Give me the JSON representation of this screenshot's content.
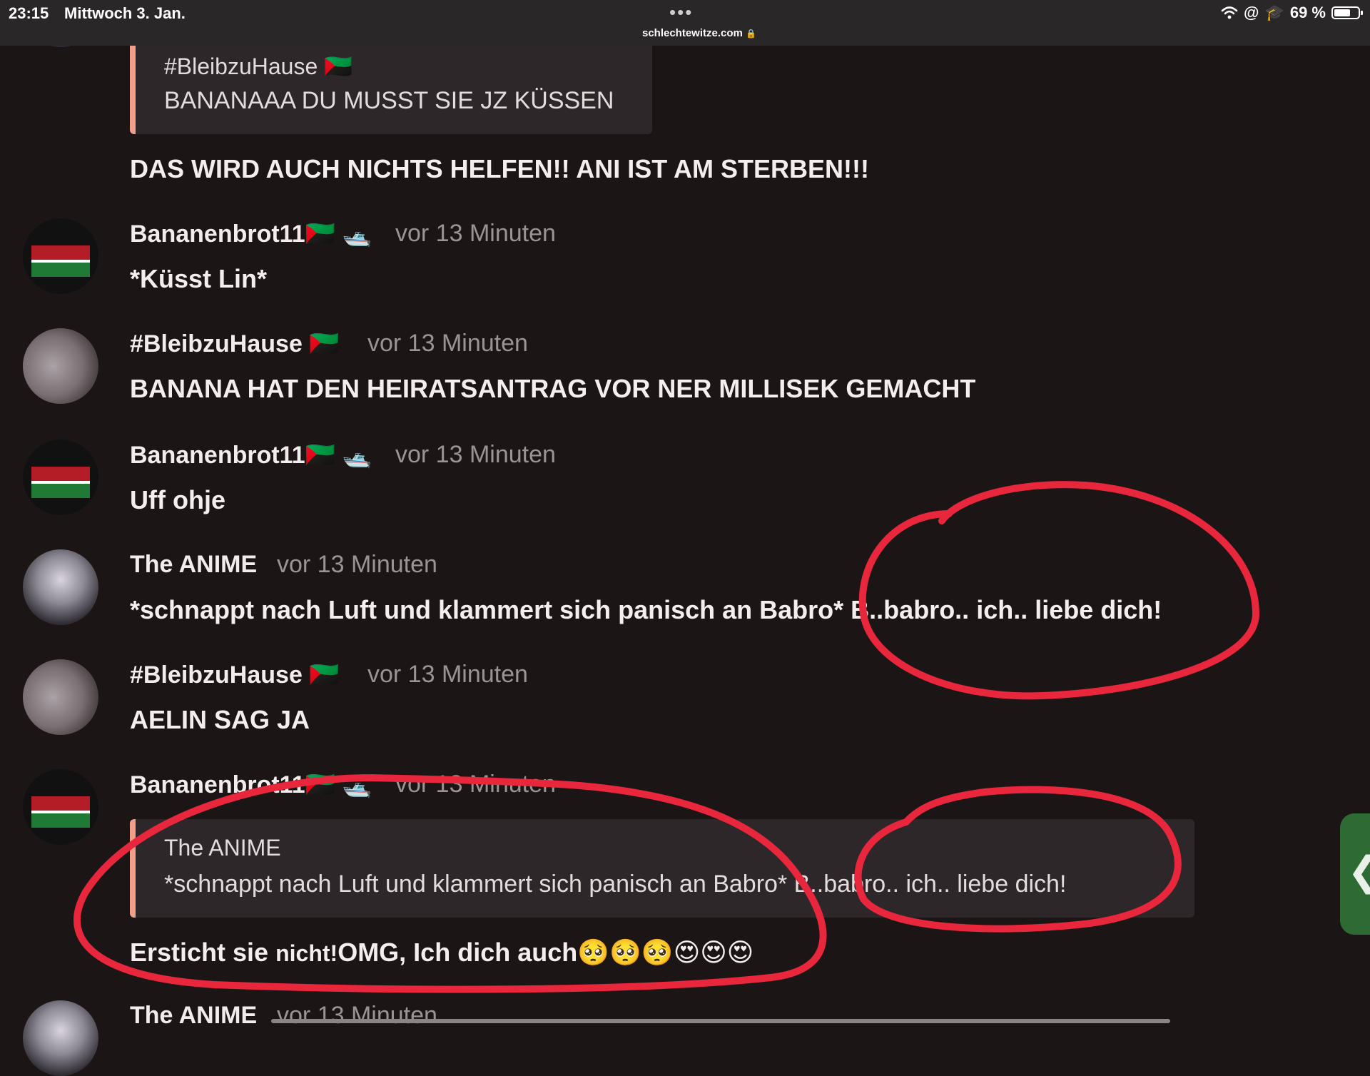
{
  "status_bar": {
    "time": "23:15",
    "date": "Mittwoch 3. Jan.",
    "url": "schlechtewitze.com",
    "battery_text": "69 %",
    "battery_level": 0.69,
    "icons": [
      "wifi-icon",
      "at-icon",
      "graduation-cap-icon",
      "battery-icon"
    ]
  },
  "feed": {
    "top_quote": {
      "name": "#BleibzuHause 🇲🇶",
      "text": "BANANAAA DU MUSST SIE JZ KÜSSEN"
    },
    "top_message": "DAS WIRD AUCH NICHTS HELFEN!! ANI IST AM STERBEN!!!",
    "posts": [
      {
        "name": "Bananenbrot11🇲🇶 🛥️",
        "time": "vor 13 Minuten",
        "text": "*Küsst Lin*",
        "avatar": "kenya-ball-avatar"
      },
      {
        "name": "#BleibzuHause 🇲🇶",
        "time": "vor 13 Minuten",
        "text": "BANANA HAT DEN HEIRATSANTRAG VOR NER MILLISEK GEMACHT",
        "avatar": "photo-avatar"
      },
      {
        "name": "Bananenbrot11🇲🇶 🛥️",
        "time": "vor 13 Minuten",
        "text": "Uff ohje",
        "avatar": "kenya-ball-avatar"
      },
      {
        "name": "The ANIME",
        "time": "vor 13 Minuten",
        "text": "*schnappt nach Luft und klammert sich panisch an Babro* B..babro.. ich.. liebe dich!",
        "avatar": "anime-avatar"
      },
      {
        "name": "#BleibzuHause 🇲🇶",
        "time": "vor 13 Minuten",
        "text": "AELIN SAG JA",
        "avatar": "photo-avatar"
      },
      {
        "name": "Bananenbrot11🇲🇶 🛥️",
        "time": "vor 13 Minuten",
        "avatar": "kenya-ball-avatar",
        "quote": {
          "name": "The ANIME",
          "text": "*schnappt nach Luft und klammert sich panisch an Babro* B..babro.. ich.. liebe dich!"
        },
        "text_part1": "Ersticht sie ",
        "text_part2": "nicht!",
        "text_part3": "OMG, Ich dich auch🥺🥺🥺😍😍😍"
      },
      {
        "name": "The ANIME",
        "time": "vor 13 Minuten",
        "avatar": "anime-avatar"
      }
    ]
  },
  "side_tab": {
    "label": "❮"
  },
  "colors": {
    "background": "#1c1516",
    "quote_border": "#f0a088",
    "annotation_red": "#e8263c"
  }
}
